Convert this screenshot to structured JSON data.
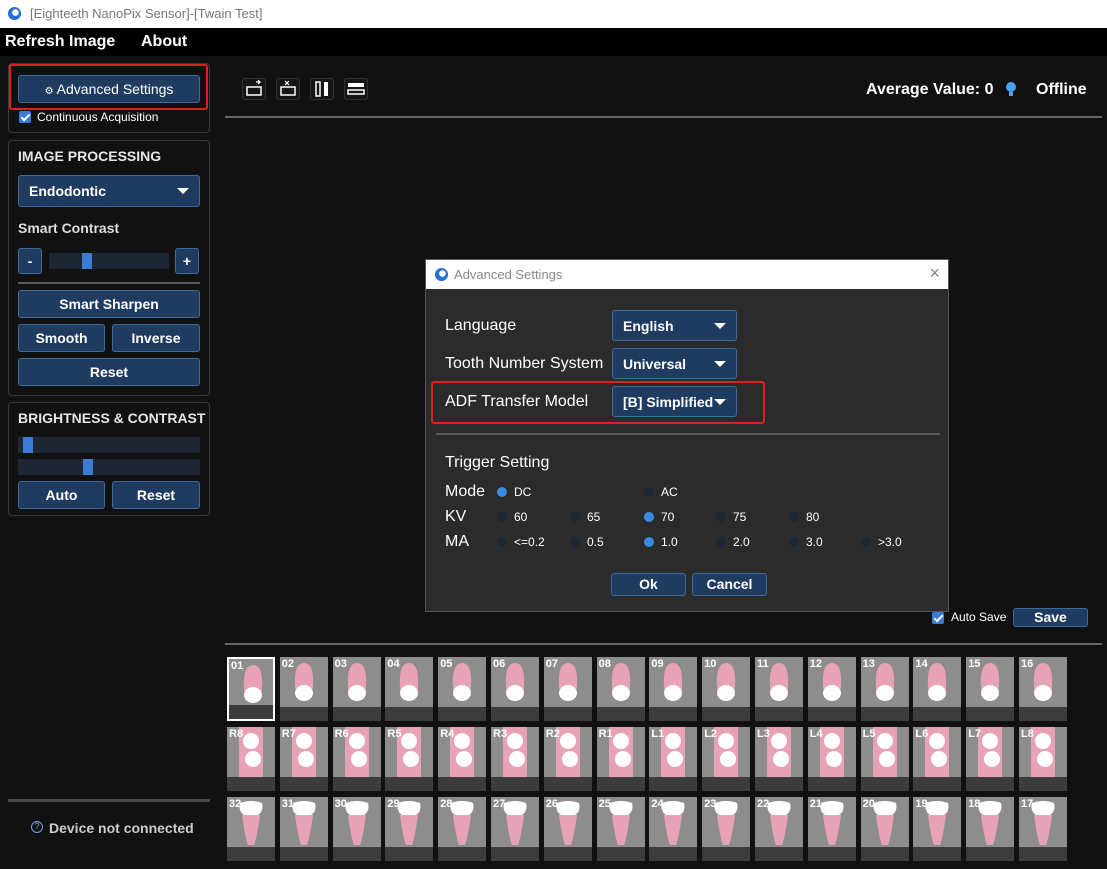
{
  "window": {
    "title": "[Eighteeth NanoPix Sensor]-[Twain Test]"
  },
  "menu": {
    "refresh": "Refresh Image",
    "about": "About"
  },
  "sidebar": {
    "advanced_button": "Advanced Settings",
    "continuous_label": "Continuous Acquisition",
    "image_processing": {
      "title": "IMAGE PROCESSING",
      "mode_value": "Endodontic",
      "smart_contrast_label": "Smart Contrast",
      "smart_contrast_level": 0.3,
      "minus": "-",
      "plus": "+",
      "smart_sharpen": "Smart Sharpen",
      "smooth": "Smooth",
      "inverse": "Inverse",
      "reset": "Reset"
    },
    "brightness_contrast": {
      "title": "BRIGHTNESS & CONTRAST",
      "brightness_level": 0.03,
      "contrast_level": 0.38,
      "auto": "Auto",
      "reset": "Reset"
    },
    "status": "Device not connected"
  },
  "toolbar": {
    "icons": [
      "flip-horizontal-icon",
      "flip-vertical-icon",
      "split-vertical-icon",
      "stack-horizontal-icon"
    ],
    "average_label": "Average Value: 0",
    "connection": "Offline"
  },
  "dialog": {
    "title": "Advanced Settings",
    "language_label": "Language",
    "language_value": "English",
    "tooth_system_label": "Tooth Number System",
    "tooth_system_value": "Universal",
    "adf_label": "ADF Transfer Model",
    "adf_value": "[B] Simplified",
    "trigger_title": "Trigger Setting",
    "mode_label": "Mode",
    "mode_options": [
      "DC",
      "AC"
    ],
    "mode_selected": "DC",
    "kv_label": "KV",
    "kv_options": [
      "60",
      "65",
      "70",
      "75",
      "80"
    ],
    "kv_selected": "70",
    "ma_label": "MA",
    "ma_options": [
      "<=0.2",
      "0.5",
      "1.0",
      "2.0",
      "3.0",
      ">3.0"
    ],
    "ma_selected": "1.0",
    "ok": "Ok",
    "cancel": "Cancel"
  },
  "autosave": {
    "label": "Auto Save",
    "save": "Save"
  },
  "teeth": {
    "row1": [
      "01",
      "02",
      "03",
      "04",
      "05",
      "06",
      "07",
      "08",
      "09",
      "10",
      "11",
      "12",
      "13",
      "14",
      "15",
      "16"
    ],
    "row2": [
      "R8",
      "R7",
      "R6",
      "R5",
      "R4",
      "R3",
      "R2",
      "R1",
      "L1",
      "L2",
      "L3",
      "L4",
      "L5",
      "L6",
      "L7",
      "L8"
    ],
    "row3": [
      "32",
      "31",
      "30",
      "29",
      "28",
      "27",
      "26",
      "25",
      "24",
      "23",
      "22",
      "21",
      "20",
      "19",
      "18",
      "17"
    ],
    "selected": "01"
  },
  "colors": {
    "accent": "#3a8be0",
    "button": "#1f3b60",
    "highlight": "#e02020"
  }
}
